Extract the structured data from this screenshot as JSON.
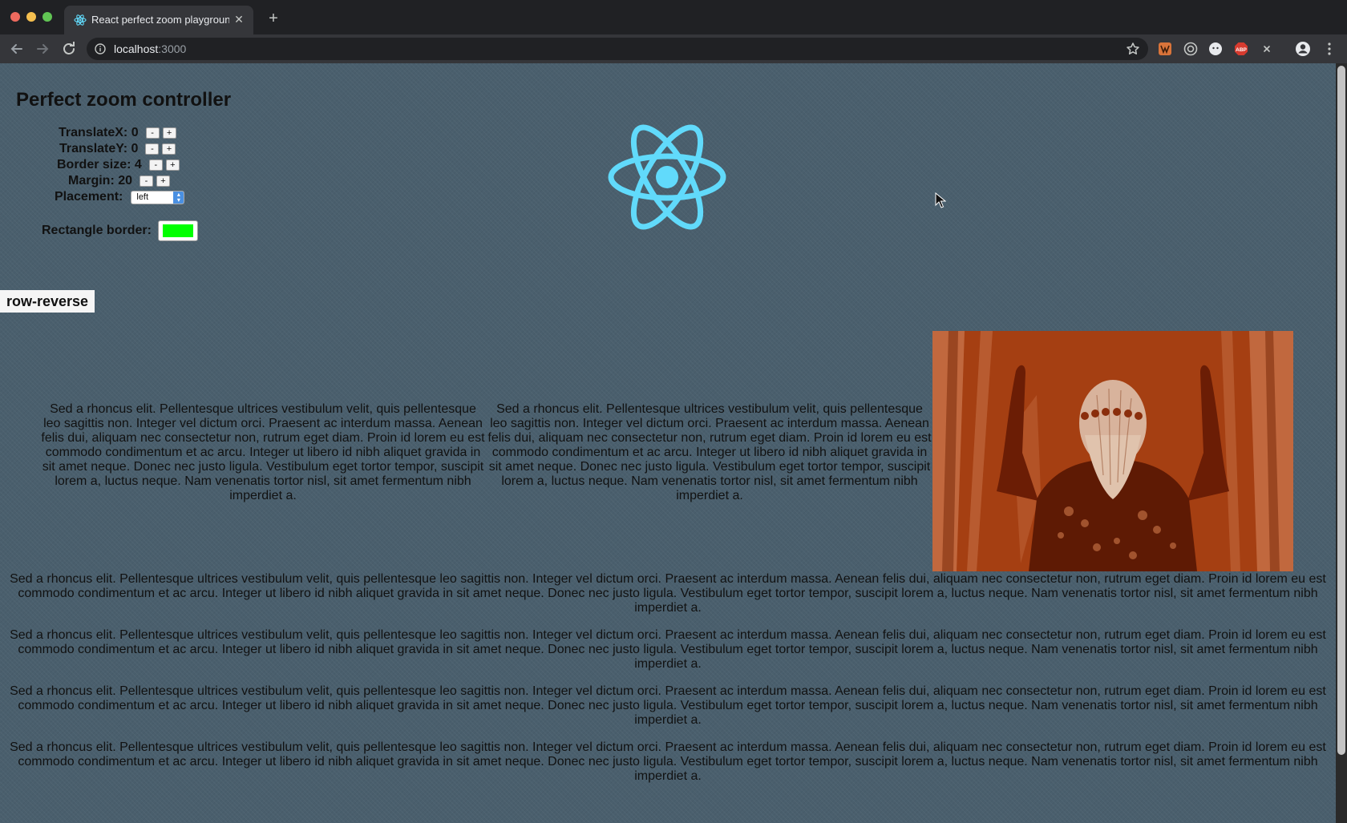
{
  "window": {
    "tab_title": "React perfect zoom playground",
    "tab_close": "✕",
    "new_tab": "+",
    "url_host": "localhost",
    "url_port": ":3000"
  },
  "page": {
    "title": "Perfect zoom controller",
    "controls": {
      "translate_x_label": "TranslateX: 0",
      "translate_y_label": "TranslateY: 0",
      "border_size_label": "Border size: 4",
      "margin_label": "Margin: 20",
      "placement_label": "Placement:",
      "placement_value": "left",
      "rectangle_border_label": "Rectangle border:",
      "rectangle_border_color": "#00ff00",
      "decrement": "-",
      "increment": "+"
    },
    "direction_badge": "row-reverse",
    "column_text_1": "Sed a rhoncus elit. Pellentesque ultrices vestibulum velit, quis pellentesque leo sagittis non. Integer vel dictum orci. Praesent ac interdum massa. Aenean felis dui, aliquam nec consectetur non, rutrum eget diam. Proin id lorem eu est commodo condimentum et ac arcu. Integer ut libero id nibh aliquet gravida in sit amet neque. Donec nec justo ligula. Vestibulum eget tortor tempor, suscipit lorem a, luctus neque. Nam venenatis tortor nisl, sit amet fermentum nibh imperdiet a.",
    "column_text_2": "Sed a rhoncus elit. Pellentesque ultrices vestibulum velit, quis pellentesque leo sagittis non. Integer vel dictum orci. Praesent ac interdum massa. Aenean felis dui, aliquam nec consectetur non, rutrum eget diam. Proin id lorem eu est commodo condimentum et ac arcu. Integer ut libero id nibh aliquet gravida in sit amet neque. Donec nec justo ligula. Vestibulum eget tortor tempor, suscipit lorem a, luctus neque. Nam venenatis tortor nisl, sit amet fermentum nibh imperdiet a.",
    "paragraphs": [
      "Sed a rhoncus elit. Pellentesque ultrices vestibulum velit, quis pellentesque leo sagittis non. Integer vel dictum orci. Praesent ac interdum massa. Aenean felis dui, aliquam nec consectetur non, rutrum eget diam. Proin id lorem eu est commodo condimentum et ac arcu. Integer ut libero id nibh aliquet gravida in sit amet neque. Donec nec justo ligula. Vestibulum eget tortor tempor, suscipit lorem a, luctus neque. Nam venenatis tortor nisl, sit amet fermentum nibh imperdiet a.",
      "Sed a rhoncus elit. Pellentesque ultrices vestibulum velit, quis pellentesque leo sagittis non. Integer vel dictum orci. Praesent ac interdum massa. Aenean felis dui, aliquam nec consectetur non, rutrum eget diam. Proin id lorem eu est commodo condimentum et ac arcu. Integer ut libero id nibh aliquet gravida in sit amet neque. Donec nec justo ligula. Vestibulum eget tortor tempor, suscipit lorem a, luctus neque. Nam venenatis tortor nisl, sit amet fermentum nibh imperdiet a.",
      "Sed a rhoncus elit. Pellentesque ultrices vestibulum velit, quis pellentesque leo sagittis non. Integer vel dictum orci. Praesent ac interdum massa. Aenean felis dui, aliquam nec consectetur non, rutrum eget diam. Proin id lorem eu est commodo condimentum et ac arcu. Integer ut libero id nibh aliquet gravida in sit amet neque. Donec nec justo ligula. Vestibulum eget tortor tempor, suscipit lorem a, luctus neque. Nam venenatis tortor nisl, sit amet fermentum nibh imperdiet a.",
      "Sed a rhoncus elit. Pellentesque ultrices vestibulum velit, quis pellentesque leo sagittis non. Integer vel dictum orci. Praesent ac interdum massa. Aenean felis dui, aliquam nec consectetur non, rutrum eget diam. Proin id lorem eu est commodo condimentum et ac arcu. Integer ut libero id nibh aliquet gravida in sit amet neque. Donec nec justo ligula. Vestibulum eget tortor tempor, suscipit lorem a, luctus neque. Nam venenatis tortor nisl, sit amet fermentum nibh imperdiet a."
    ]
  },
  "icons": {
    "favicon": "react-logo-icon",
    "back": "arrow-left-icon",
    "forward": "arrow-right-icon",
    "reload": "reload-icon",
    "site_info": "info-icon",
    "bookmark": "star-icon",
    "profile": "account-circle-icon",
    "menu": "kebab-menu-icon"
  },
  "colors": {
    "page_background": "#4a5f6d",
    "react_blue": "#61dafb",
    "photo_base": "#a53f12"
  }
}
